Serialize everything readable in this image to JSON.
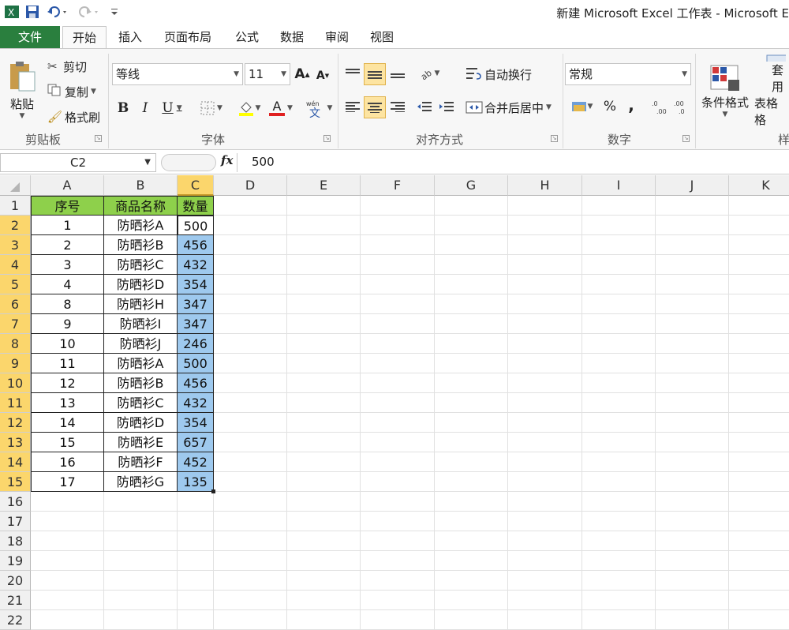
{
  "window": {
    "title": "新建 Microsoft Excel 工作表 - Microsoft E"
  },
  "tabs": [
    {
      "label": "文件"
    },
    {
      "label": "开始"
    },
    {
      "label": "插入"
    },
    {
      "label": "页面布局"
    },
    {
      "label": "公式"
    },
    {
      "label": "数据"
    },
    {
      "label": "审阅"
    },
    {
      "label": "视图"
    }
  ],
  "ribbon": {
    "clipboard": {
      "paste": "粘贴",
      "cut": "剪切",
      "copy": "复制",
      "format_painter": "格式刷",
      "label": "剪贴板"
    },
    "font": {
      "name": "等线",
      "size": "11",
      "bold": "B",
      "italic": "I",
      "underline": "U",
      "label": "字体",
      "font_color": "A",
      "grow": "A",
      "shrink": "A"
    },
    "alignment": {
      "wrap": "自动换行",
      "merge": "合并后居中",
      "label": "对齐方式"
    },
    "number": {
      "format": "常规",
      "percent": "%",
      "comma": ",",
      "label": "数字"
    },
    "styles": {
      "conditional": "条件格式",
      "table1": "套用",
      "table2": "表格格",
      "label": "样"
    }
  },
  "formula_bar": {
    "name_box": "C2",
    "fx": "fx",
    "value": "500"
  },
  "columns": [
    "A",
    "B",
    "C",
    "D",
    "E",
    "F",
    "G",
    "H",
    "I",
    "J",
    "K"
  ],
  "rows": [
    "1",
    "2",
    "3",
    "4",
    "5",
    "6",
    "7",
    "8",
    "9",
    "10",
    "11",
    "12",
    "13",
    "14",
    "15",
    "16",
    "17",
    "18",
    "19",
    "20",
    "21",
    "22"
  ],
  "table": {
    "headers": [
      "序号",
      "商品名称",
      "数量"
    ],
    "rows": [
      [
        "1",
        "防晒衫A",
        "500"
      ],
      [
        "2",
        "防晒衫B",
        "456"
      ],
      [
        "3",
        "防晒衫C",
        "432"
      ],
      [
        "4",
        "防晒衫D",
        "354"
      ],
      [
        "8",
        "防晒衫H",
        "347"
      ],
      [
        "9",
        "防晒衫I",
        "347"
      ],
      [
        "10",
        "防晒衫J",
        "246"
      ],
      [
        "11",
        "防晒衫A",
        "500"
      ],
      [
        "12",
        "防晒衫B",
        "456"
      ],
      [
        "13",
        "防晒衫C",
        "432"
      ],
      [
        "14",
        "防晒衫D",
        "354"
      ],
      [
        "15",
        "防晒衫E",
        "657"
      ],
      [
        "16",
        "防晒衫F",
        "452"
      ],
      [
        "17",
        "防晒衫G",
        "135"
      ]
    ]
  },
  "colors": {
    "header_green": "#8ed04b",
    "selection_blue": "#9ec9ee",
    "header_highlight": "#fbd66c",
    "file_tab": "#2a7f3e"
  }
}
